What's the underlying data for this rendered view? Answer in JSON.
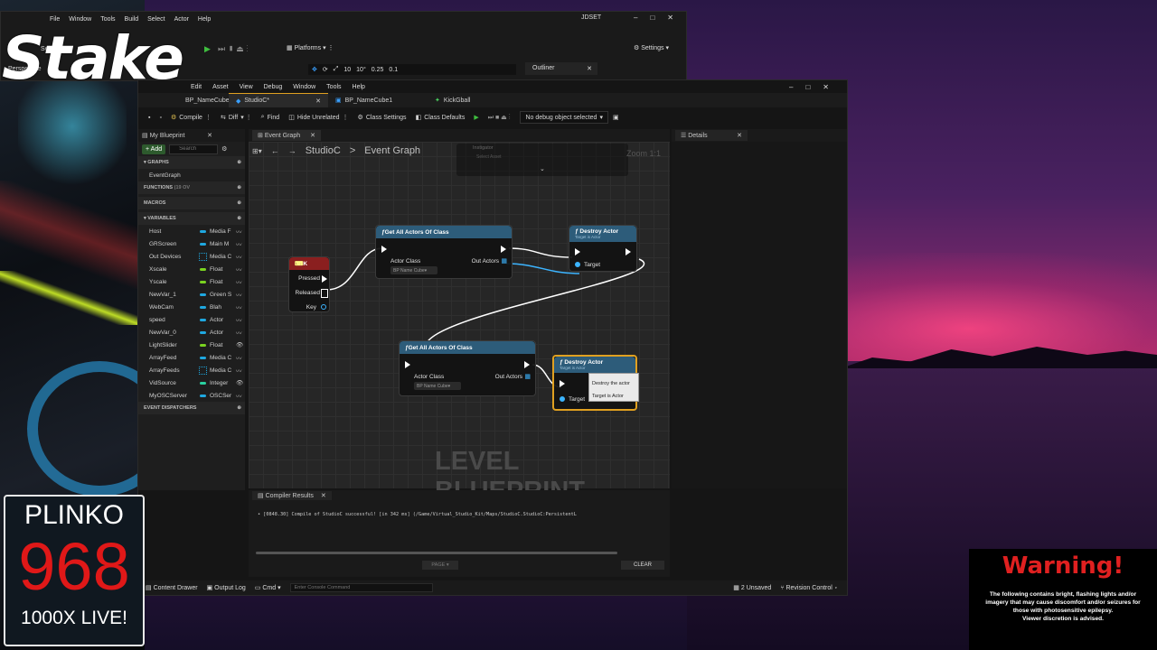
{
  "overlay": {
    "brand": "Stake",
    "plinko": {
      "title": "PLINKO",
      "number": "968",
      "subtitle": "1000X LIVE!"
    },
    "warning": {
      "title": "Warning!",
      "lines": [
        "The following contains bright, flashing lights and/or",
        "imagery that may cause discomfort and/or seizures for",
        "those with photosensitive epilepsy.",
        "Viewer discretion is advised."
      ]
    }
  },
  "bg_window": {
    "menu": [
      "File",
      "Window",
      "Tools",
      "Build",
      "Select",
      "Actor",
      "Help"
    ],
    "title": "JDSET",
    "platforms": "Platforms",
    "settings": "Settings",
    "selection": "Selection",
    "perspective": "Perspective",
    "outliner": "Outliner",
    "snap_values": [
      "10",
      "10°",
      "0.25",
      "0.1"
    ]
  },
  "main": {
    "menu": [
      "Edit",
      "Asset",
      "View",
      "Debug",
      "Window",
      "Tools",
      "Help"
    ],
    "tabs": [
      {
        "label": "BP_NameCube"
      },
      {
        "label": "StudioC*"
      },
      {
        "label": "BP_NameCube1"
      },
      {
        "label": "KickGball"
      }
    ],
    "toolbar": {
      "compile": "Compile",
      "diff": "Diff",
      "find": "Find",
      "hide_unrelated": "Hide Unrelated",
      "class_settings": "Class Settings",
      "class_defaults": "Class Defaults",
      "debug_select": "No debug object selected"
    },
    "my_blueprint": {
      "title": "My Blueprint",
      "add": "Add",
      "search_placeholder": "Search",
      "graphs": "GRAPHS",
      "event_graph": "EventGraph",
      "functions": "FUNCTIONS",
      "functions_count": "(19 OV",
      "macros": "MACROS",
      "variables_header": "VARIABLES",
      "variables": [
        {
          "name": "Host",
          "type": "Media F",
          "color": "#1fa8e0",
          "eye": "〰"
        },
        {
          "name": "GRScreen",
          "type": "Main M",
          "color": "#1fa8e0",
          "eye": "〰"
        },
        {
          "name": "Out Devices",
          "type": "Media C",
          "color": "#1fa8e0",
          "eye": "〰",
          "grid": true
        },
        {
          "name": "Xscale",
          "type": "Float",
          "color": "#7ad320",
          "eye": "〰"
        },
        {
          "name": "Yscale",
          "type": "Float",
          "color": "#7ad320",
          "eye": "〰"
        },
        {
          "name": "NewVar_1",
          "type": "Green S",
          "color": "#1fa8e0",
          "eye": "〰"
        },
        {
          "name": "WebCam",
          "type": "Blah",
          "color": "#1fa8e0",
          "eye": "〰"
        },
        {
          "name": "speed",
          "type": "Actor",
          "color": "#1fa8e0",
          "eye": "〰"
        },
        {
          "name": "NewVar_0",
          "type": "Actor",
          "color": "#1fa8e0",
          "eye": "〰"
        },
        {
          "name": "LightSlider",
          "type": "Float",
          "color": "#7ad320",
          "eye": "👁"
        },
        {
          "name": "ArrayFeed",
          "type": "Media C",
          "color": "#1fa8e0",
          "eye": "〰"
        },
        {
          "name": "ArrayFeeds",
          "type": "Media C",
          "color": "#1fa8e0",
          "eye": "〰",
          "grid": true
        },
        {
          "name": "VidSource",
          "type": "Integer",
          "color": "#2ad1a0",
          "eye": "👁"
        },
        {
          "name": "MyOSCServer",
          "type": "OSCSer",
          "color": "#1fa8e0",
          "eye": "〰"
        }
      ],
      "event_dispatchers": "EVENT DISPATCHERS"
    },
    "graph": {
      "tab": "Event Graph",
      "breadcrumb_root": "StudioC",
      "breadcrumb_sep": ">",
      "breadcrumb_leaf": "Event Graph",
      "zoom": "Zoom 1:1",
      "instigator": "Instigator",
      "select_asset": "Select Asset",
      "watermark": "LEVEL BLUEPRINT",
      "nodes": {
        "k": {
          "title": "K",
          "pressed": "Pressed",
          "released": "Released",
          "key": "Key"
        },
        "gaa1": {
          "title": "Get All Actors Of Class",
          "actor_class": "Actor Class",
          "class_value": "BP Name Cube",
          "out_actors": "Out Actors"
        },
        "da1": {
          "title": "Destroy Actor",
          "subtitle": "Target is Actor",
          "target": "Target"
        },
        "gaa2": {
          "title": "Get All Actors Of Class",
          "actor_class": "Actor Class",
          "class_value": "BP Name Cube",
          "out_actors": "Out Actors"
        },
        "da2": {
          "title": "Destroy Actor",
          "subtitle": "Target is Actor",
          "target": "Target"
        }
      },
      "tooltip": {
        "line1": "Destroy the actor",
        "line2": "Target is Actor"
      }
    },
    "details": {
      "title": "Details"
    },
    "compiler": {
      "title": "Compiler Results",
      "message": "• [0848.30] Compile of StudioC successful! [in 342 ms] (/Game/Virtual_Studio_Kit/Maps/StudioC.StudioC:PersistentL",
      "page": "PAGE",
      "clear": "CLEAR"
    },
    "status": {
      "content_drawer": "Content Drawer",
      "output_log": "Output Log",
      "cmd": "Cmd",
      "console_placeholder": "Enter Console Command",
      "unsaved": "2 Unsaved",
      "revision": "Revision Control"
    }
  },
  "colors": {
    "accent": "#e0a020",
    "exec": "#ffffff",
    "object_pin": "#3cb4ff",
    "func_header": "#2d5c7a",
    "event_header": "#8a1f1f"
  }
}
